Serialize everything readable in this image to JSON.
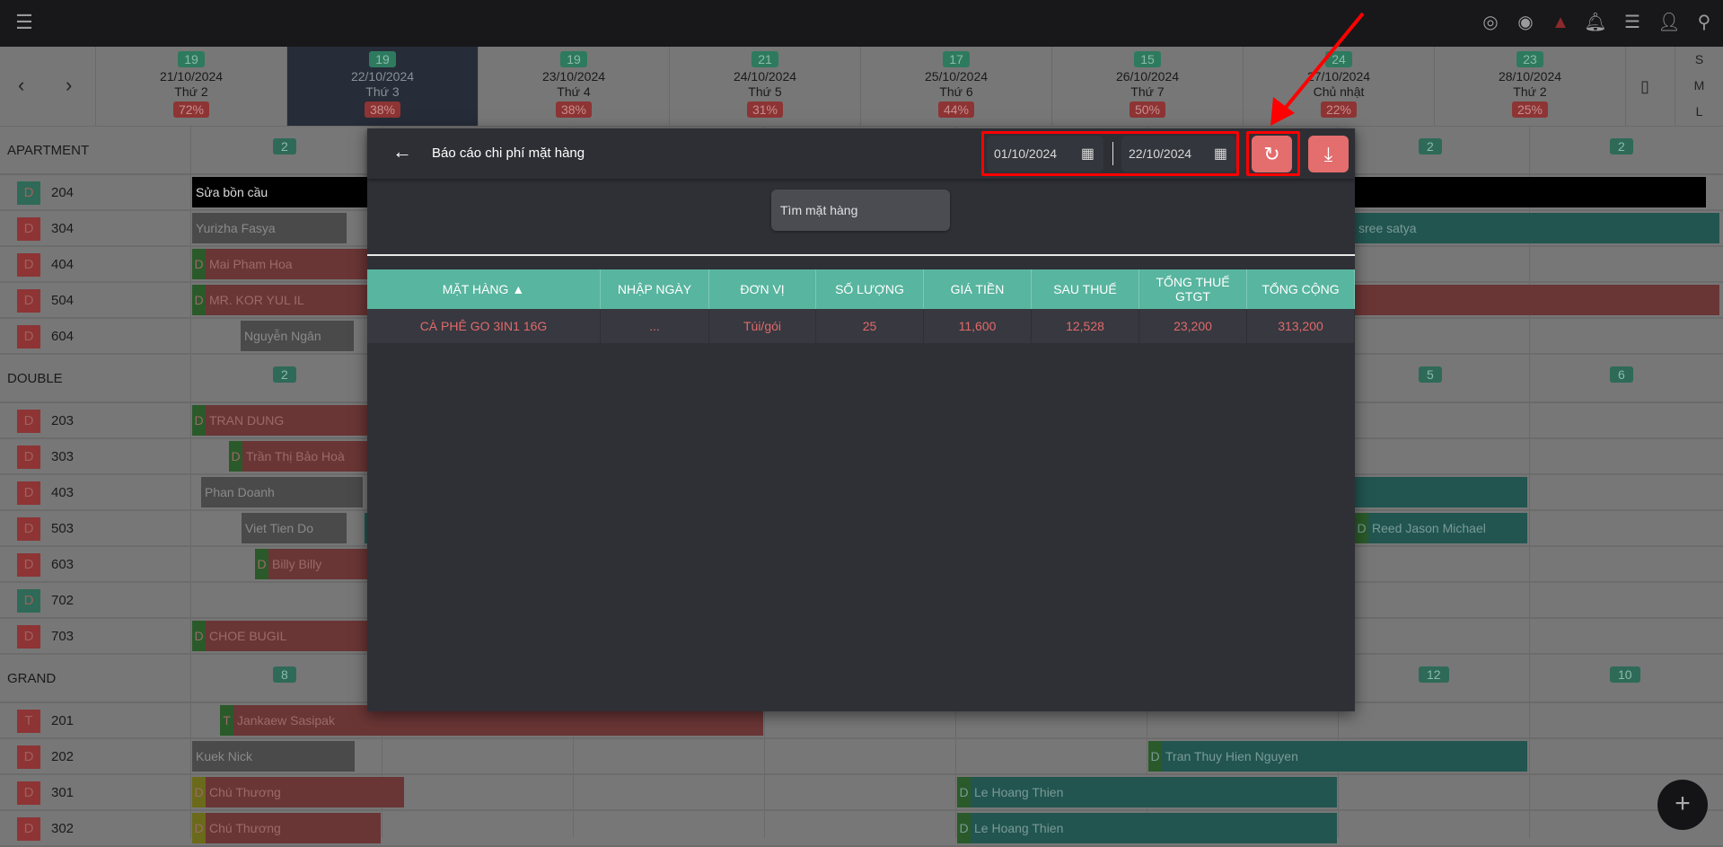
{
  "topbar": {
    "menu_icon": "hamburger-icon",
    "icons": [
      "fingerprint-icon",
      "eye-icon",
      "warning-icon",
      "bell-icon",
      "list-icon",
      "add-user-icon",
      "search-icon"
    ]
  },
  "nav": {
    "prev": "‹",
    "next": "›",
    "calendar_icon": "calendar-icon",
    "sizes": [
      "S",
      "M",
      "L"
    ]
  },
  "days": [
    {
      "count": "19",
      "date": "21/10/2024",
      "weekday": "Thứ 2",
      "occupancy": "72%"
    },
    {
      "count": "19",
      "date": "22/10/2024",
      "weekday": "Thứ 3",
      "occupancy": "38%",
      "selected": true
    },
    {
      "count": "19",
      "date": "23/10/2024",
      "weekday": "Thứ 4",
      "occupancy": "38%"
    },
    {
      "count": "21",
      "date": "24/10/2024",
      "weekday": "Thứ 5",
      "occupancy": "31%"
    },
    {
      "count": "17",
      "date": "25/10/2024",
      "weekday": "Thứ 6",
      "occupancy": "44%"
    },
    {
      "count": "15",
      "date": "26/10/2024",
      "weekday": "Thứ 7",
      "occupancy": "50%"
    },
    {
      "count": "24",
      "date": "27/10/2024",
      "weekday": "Chủ nhật",
      "occupancy": "22%"
    },
    {
      "count": "23",
      "date": "28/10/2024",
      "weekday": "Thứ 2",
      "occupancy": "25%"
    }
  ],
  "groups": [
    {
      "name": "APARTMENT",
      "counts": [
        "2",
        "2",
        "2"
      ],
      "rooms": [
        {
          "badge": "D",
          "status": "clean",
          "number": "204",
          "bars": [
            {
              "label": "Sửa bồn cầu",
              "kind": "block"
            }
          ]
        },
        {
          "badge": "D",
          "status": "dirty",
          "number": "304",
          "bars": [
            {
              "label": "Yurizha Fasya",
              "kind": "out"
            },
            {
              "label": "sree satya",
              "kind": "in"
            }
          ]
        },
        {
          "badge": "D",
          "status": "dirty",
          "number": "404",
          "bars": [
            {
              "label": "Mai Pham Hoa",
              "kind": "stay",
              "prefix": "D"
            }
          ]
        },
        {
          "badge": "D",
          "status": "dirty",
          "number": "504",
          "bars": [
            {
              "label": "MR. KOR YUL IL",
              "kind": "stay",
              "prefix": "D"
            },
            {
              "label": "",
              "kind": "stay"
            }
          ]
        },
        {
          "badge": "D",
          "status": "dirty",
          "number": "604",
          "bars": [
            {
              "label": "Nguyễn Ngân",
              "kind": "out"
            }
          ]
        }
      ]
    },
    {
      "name": "DOUBLE",
      "counts": [
        "2",
        "5",
        "6"
      ],
      "rooms": [
        {
          "badge": "D",
          "status": "dirty",
          "number": "203",
          "bars": [
            {
              "label": "TRAN DUNG",
              "kind": "stay",
              "prefix": "D"
            }
          ]
        },
        {
          "badge": "D",
          "status": "dirty",
          "number": "303",
          "bars": [
            {
              "label": "Trần Thị Bảo Hoà",
              "kind": "stay",
              "prefix": "D"
            }
          ]
        },
        {
          "badge": "D",
          "status": "dirty",
          "number": "403",
          "bars": [
            {
              "label": "Phan Doanh",
              "kind": "out"
            },
            {
              "label": "",
              "kind": "in"
            }
          ]
        },
        {
          "badge": "D",
          "status": "dirty",
          "number": "503",
          "bars": [
            {
              "label": "Viet Tien Do",
              "kind": "out"
            },
            {
              "label": "",
              "kind": "in"
            },
            {
              "label": "Reed Jason Michael",
              "kind": "in",
              "prefix": "D"
            }
          ]
        },
        {
          "badge": "D",
          "status": "dirty",
          "number": "603",
          "bars": [
            {
              "label": "Billy Billy",
              "kind": "stay",
              "prefix": "D"
            }
          ]
        },
        {
          "badge": "D",
          "status": "clean",
          "number": "702",
          "bars": []
        },
        {
          "badge": "D",
          "status": "dirty",
          "number": "703",
          "bars": [
            {
              "label": "CHOE BUGIL",
              "kind": "stay",
              "prefix": "D"
            }
          ]
        }
      ]
    },
    {
      "name": "GRAND",
      "counts": [
        "8",
        "12",
        "10"
      ],
      "rooms": [
        {
          "badge": "T",
          "status": "dirty",
          "number": "201",
          "bars": [
            {
              "label": "Jankaew Sasipak",
              "kind": "stay",
              "prefix": "T"
            }
          ]
        },
        {
          "badge": "D",
          "status": "dirty",
          "number": "202",
          "bars": [
            {
              "label": "Kuek Nick",
              "kind": "out"
            },
            {
              "label": "Tran Thuy Hien Nguyen",
              "kind": "in",
              "prefix": "D"
            }
          ]
        },
        {
          "badge": "D",
          "status": "dirty",
          "number": "301",
          "bars": [
            {
              "label": "Chú Thương",
              "kind": "stay",
              "prefix": "D",
              "prefix_color": "olive"
            },
            {
              "label": "Le Hoang Thien",
              "kind": "in",
              "prefix": "D"
            }
          ]
        },
        {
          "badge": "D",
          "status": "dirty",
          "number": "302",
          "bars": [
            {
              "label": "Chú Thương",
              "kind": "stay",
              "prefix": "D",
              "prefix_color": "olive"
            },
            {
              "label": "Le Hoang Thien",
              "kind": "in",
              "prefix": "D"
            }
          ]
        }
      ]
    }
  ],
  "colors": {
    "clean": "#2e6a57",
    "dirty": "#8e3434",
    "stay": "#6a3535",
    "in": "#225550",
    "out": "#4a4a4a",
    "block": "#000000",
    "accent": "#58b59f",
    "danger": "#e46d6d"
  },
  "modal": {
    "title": "Báo cáo chi phí mặt hàng",
    "from_date": "01/10/2024",
    "to_date": "22/10/2024",
    "search_placeholder": "Tìm mặt hàng",
    "columns": [
      "MẶT HÀNG ▲",
      "NHẬP NGÀY",
      "ĐƠN VỊ",
      "SỐ LƯỢNG",
      "GIÁ TIỀN",
      "SAU THUẾ",
      "TỔNG THUẾ GTGT",
      "TỔNG CỘNG"
    ],
    "rows": [
      [
        "CÀ PHÊ GO 3IN1 16G",
        "...",
        "Túi/gói",
        "25",
        "11,600",
        "12,528",
        "23,200",
        "313,200"
      ]
    ]
  },
  "fab": "+"
}
